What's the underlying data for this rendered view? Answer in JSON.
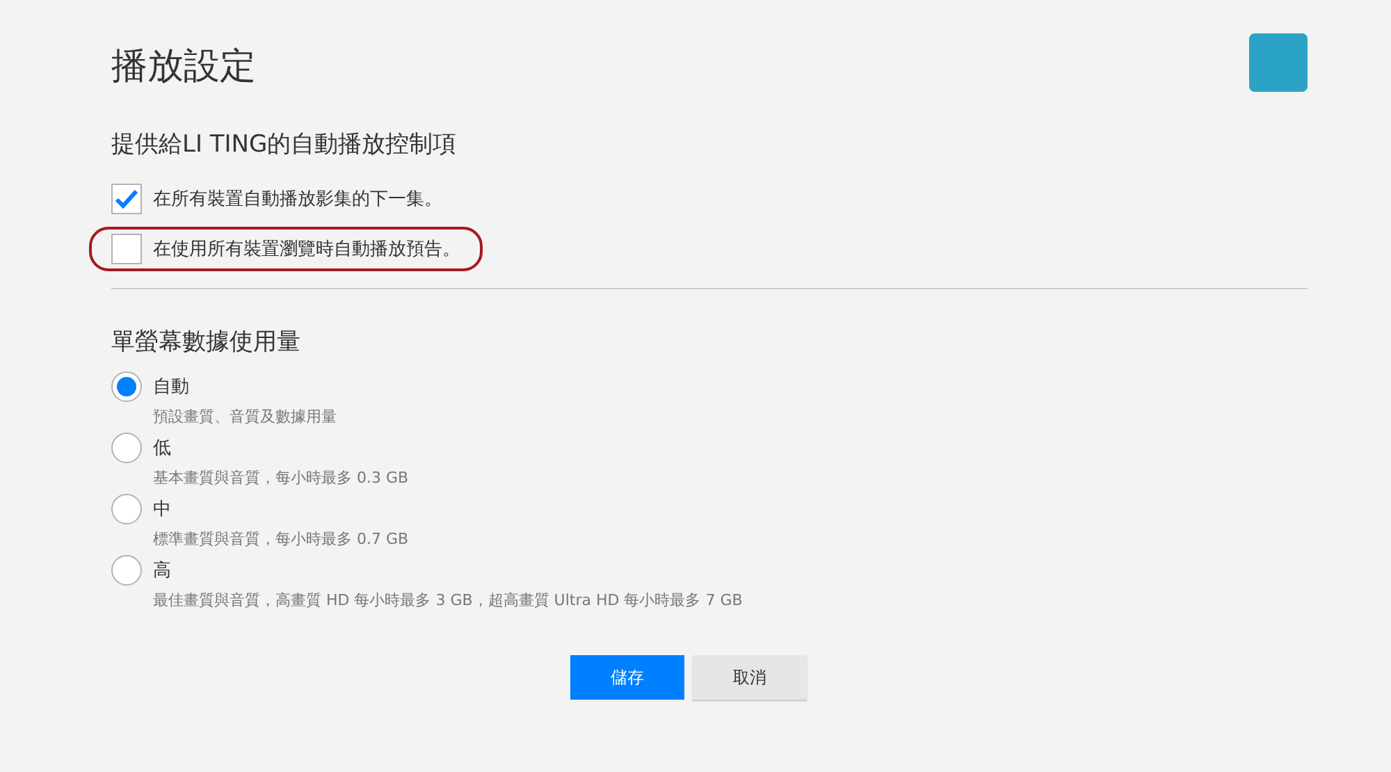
{
  "title": "播放設定",
  "autoplay": {
    "heading": "提供給LI TING的自動播放控制項",
    "options": [
      {
        "label": "在所有裝置自動播放影集的下一集。",
        "checked": true,
        "highlighted": false
      },
      {
        "label": "在使用所有裝置瀏覽時自動播放預告。",
        "checked": false,
        "highlighted": true
      }
    ]
  },
  "data_usage": {
    "heading": "單螢幕數據使用量",
    "options": [
      {
        "label": "自動",
        "description": "預設畫質、音質及數據用量",
        "selected": true
      },
      {
        "label": "低",
        "description": "基本畫質與音質，每小時最多 0.3 GB",
        "selected": false
      },
      {
        "label": "中",
        "description": "標準畫質與音質，每小時最多 0.7 GB",
        "selected": false
      },
      {
        "label": "高",
        "description": "最佳畫質與音質，高畫質 HD 每小時最多 3 GB，超高畫質 Ultra HD 每小時最多 7 GB",
        "selected": false
      }
    ]
  },
  "buttons": [
    {
      "label": "儲存",
      "kind": "primary"
    },
    {
      "label": "取消",
      "kind": "secondary"
    }
  ]
}
